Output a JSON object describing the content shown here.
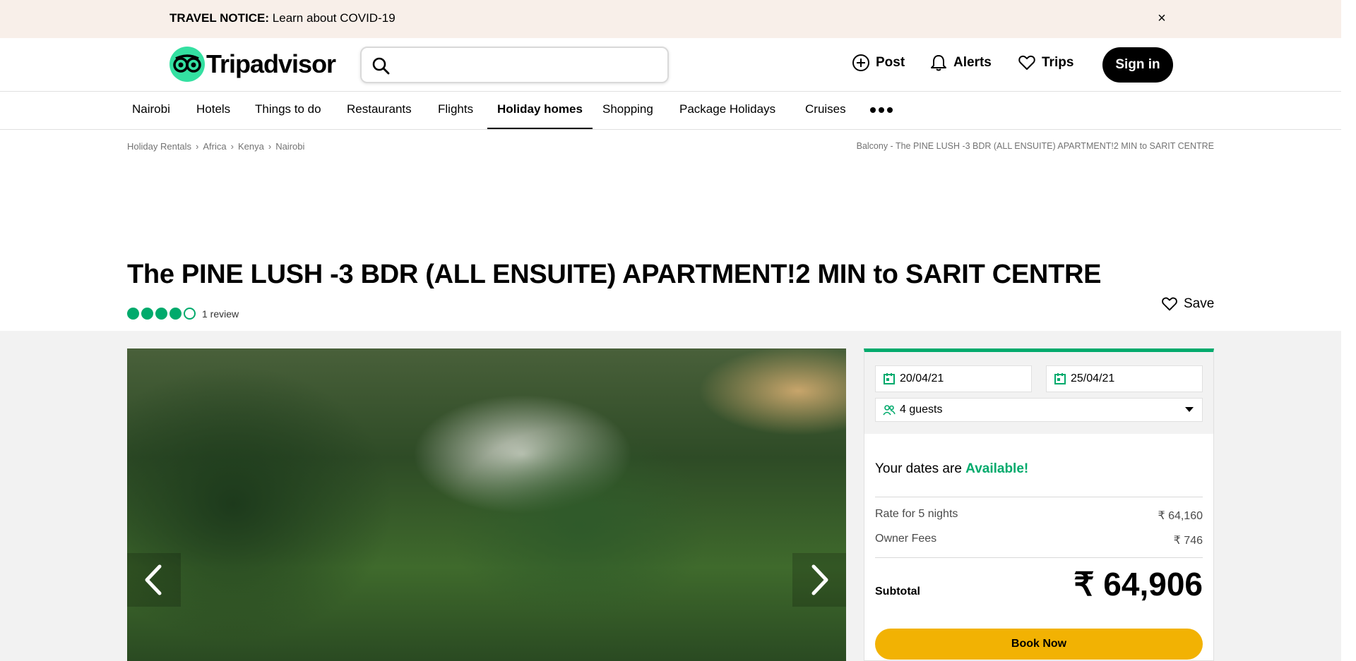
{
  "notice": {
    "label": "TRAVEL NOTICE:",
    "text": "Learn about COVID-19",
    "close": "×"
  },
  "header": {
    "logo_text": "Tripadvisor",
    "search_placeholder": "",
    "links": {
      "post": "Post",
      "alerts": "Alerts",
      "trips": "Trips"
    },
    "signin": "Sign in"
  },
  "nav": {
    "items": [
      "Nairobi",
      "Hotels",
      "Things to do",
      "Restaurants",
      "Flights",
      "Holiday homes",
      "Shopping",
      "Package Holidays",
      "Cruises"
    ],
    "active": "Holiday homes"
  },
  "breadcrumb": {
    "items": [
      "Holiday Rentals",
      "Africa",
      "Kenya",
      "Nairobi"
    ],
    "right": "Balcony - The PINE LUSH -3 BDR (ALL ENSUITE) APARTMENT!2 MIN to SARIT CENTRE"
  },
  "listing": {
    "title": "The PINE LUSH -3 BDR (ALL ENSUITE) APARTMENT!2 MIN to SARIT CENTRE",
    "rating": 4,
    "rating_max": 5,
    "review_count": "1 review",
    "save": "Save"
  },
  "booking": {
    "checkin": "20/04/21",
    "checkout": "25/04/21",
    "guests": "4 guests",
    "availability_prefix": "Your dates are",
    "availability_status": "Available!",
    "rate_label": "Rate for 5 nights",
    "rate_value": "₹ 64,160",
    "fees_label": "Owner Fees",
    "fees_value": "₹ 746",
    "subtotal_label": "Subtotal",
    "subtotal_value": "₹ 64,906",
    "book_button": "Book Now"
  },
  "colors": {
    "brand_green": "#00aa6c",
    "logo_mint": "#34e0a1",
    "book_yellow": "#f2b203",
    "notice_bg": "#f8efe9"
  }
}
